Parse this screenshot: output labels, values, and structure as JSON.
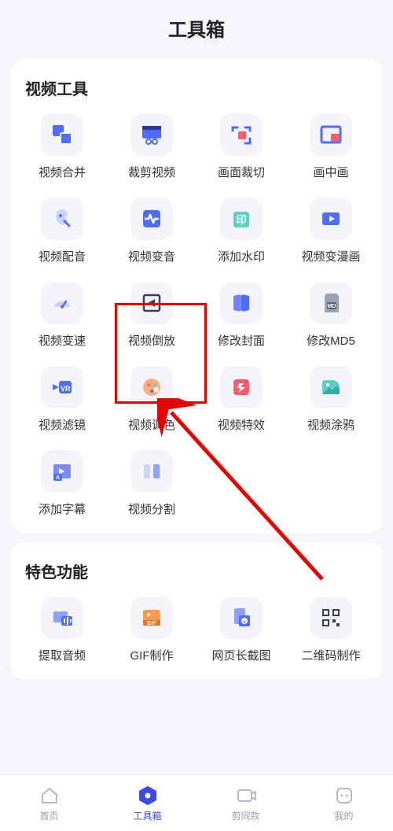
{
  "title": "工具箱",
  "sections": [
    {
      "title": "视频工具",
      "tools": [
        {
          "name": "video-merge",
          "label": "视频合并"
        },
        {
          "name": "crop-video",
          "label": "裁剪视频"
        },
        {
          "name": "frame-crop",
          "label": "画面裁切"
        },
        {
          "name": "pip",
          "label": "画中画"
        },
        {
          "name": "video-dub",
          "label": "视频配音"
        },
        {
          "name": "voice-change",
          "label": "视频变音"
        },
        {
          "name": "watermark",
          "label": "添加水印"
        },
        {
          "name": "to-comic",
          "label": "视频变漫画"
        },
        {
          "name": "speed",
          "label": "视频变速"
        },
        {
          "name": "reverse",
          "label": "视频倒放"
        },
        {
          "name": "cover",
          "label": "修改封面"
        },
        {
          "name": "md5",
          "label": "修改MD5"
        },
        {
          "name": "filter",
          "label": "视频滤镜"
        },
        {
          "name": "color",
          "label": "视频调色"
        },
        {
          "name": "effects",
          "label": "视频特效"
        },
        {
          "name": "doodle",
          "label": "视频涂鸦"
        },
        {
          "name": "subtitle",
          "label": "添加字幕"
        },
        {
          "name": "split",
          "label": "视频分割"
        }
      ]
    },
    {
      "title": "特色功能",
      "tools": [
        {
          "name": "extract-audio",
          "label": "提取音频"
        },
        {
          "name": "gif",
          "label": "GIF制作"
        },
        {
          "name": "long-shot",
          "label": "网页长截图"
        },
        {
          "name": "qrcode",
          "label": "二维码制作"
        }
      ]
    }
  ],
  "tabs": [
    {
      "name": "home",
      "label": "首页"
    },
    {
      "name": "toolbox",
      "label": "工具箱",
      "active": true
    },
    {
      "name": "clip",
      "label": "剪同款"
    },
    {
      "name": "mine",
      "label": "我的"
    }
  ],
  "annotation": {
    "highlight_tool": "reverse"
  }
}
